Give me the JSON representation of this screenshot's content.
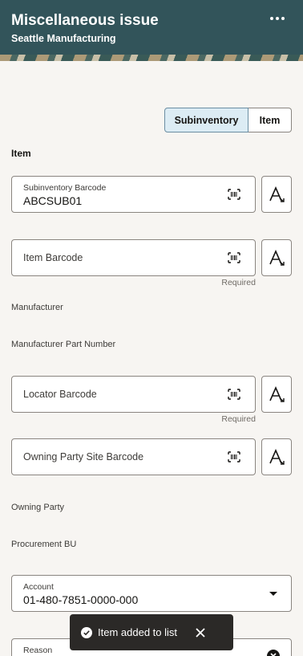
{
  "header": {
    "title": "Miscellaneous issue",
    "subtitle": "Seattle Manufacturing",
    "more_icon": "more-horizontal-icon"
  },
  "toggle": {
    "options": [
      "Subinventory",
      "Item"
    ],
    "selected": "Subinventory"
  },
  "section": {
    "item_heading": "Item"
  },
  "fields": {
    "subinventory": {
      "label": "Subinventory Barcode",
      "value": "ABCSUB01"
    },
    "item_barcode": {
      "placeholder": "Item Barcode",
      "hint": "Required"
    },
    "manufacturer": "Manufacturer",
    "manufacturer_part_number": "Manufacturer Part Number",
    "locator_barcode": {
      "placeholder": "Locator Barcode",
      "hint": "Required"
    },
    "owning_party_site": {
      "placeholder": "Owning Party Site Barcode"
    },
    "owning_party": "Owning Party",
    "procurement_bu": "Procurement BU",
    "account": {
      "label": "Account",
      "value": "01-480-7851-0000-000"
    },
    "reason": {
      "label": "Reason"
    }
  },
  "toast": {
    "message": "Item added to list"
  },
  "colors": {
    "header_bg": "#32545a",
    "toggle_active": "#dcecf4",
    "toast_bg": "#2b2927"
  }
}
